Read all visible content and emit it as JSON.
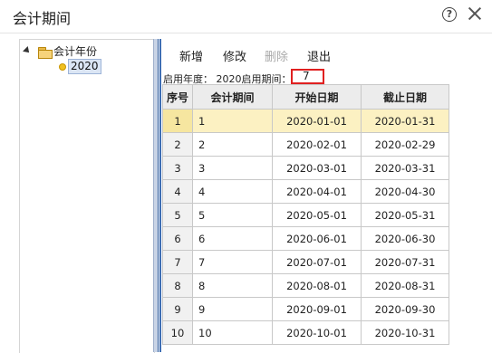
{
  "window": {
    "title": "会计期间"
  },
  "tree": {
    "root_label": "会计年份",
    "leaf_label": "2020"
  },
  "toolbar": {
    "add": "新增",
    "edit": "修改",
    "delete": "删除",
    "exit": "退出"
  },
  "info": {
    "text": "启用年度： 2020启用期间：",
    "period_value": "7"
  },
  "table": {
    "headers": [
      "序号",
      "会计期间",
      "开始日期",
      "截止日期"
    ],
    "rows": [
      [
        "1",
        "1",
        "2020-01-01",
        "2020-01-31"
      ],
      [
        "2",
        "2",
        "2020-02-01",
        "2020-02-29"
      ],
      [
        "3",
        "3",
        "2020-03-01",
        "2020-03-31"
      ],
      [
        "4",
        "4",
        "2020-04-01",
        "2020-04-30"
      ],
      [
        "5",
        "5",
        "2020-05-01",
        "2020-05-31"
      ],
      [
        "6",
        "6",
        "2020-06-01",
        "2020-06-30"
      ],
      [
        "7",
        "7",
        "2020-07-01",
        "2020-07-31"
      ],
      [
        "8",
        "8",
        "2020-08-01",
        "2020-08-31"
      ],
      [
        "9",
        "9",
        "2020-09-01",
        "2020-09-30"
      ],
      [
        "10",
        "10",
        "2020-10-01",
        "2020-10-31"
      ]
    ],
    "selected_row": 0
  },
  "colors": {
    "selected_row": "#fcf1c2",
    "highlight_border": "#e02020",
    "splitter": "#3f6fb4"
  }
}
